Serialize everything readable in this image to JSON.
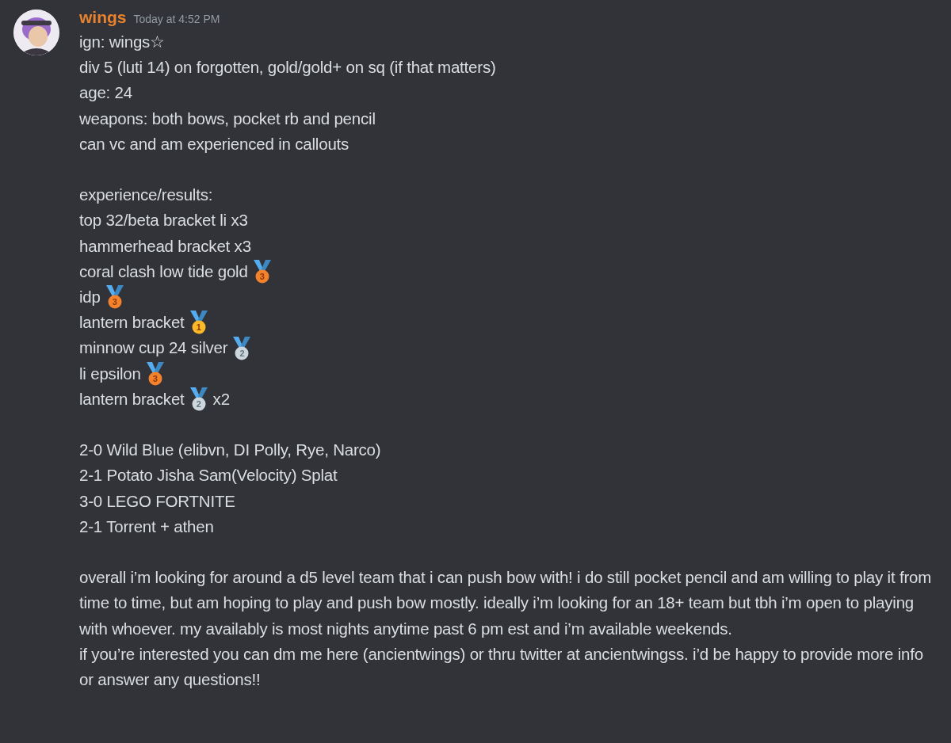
{
  "message": {
    "author": "wings",
    "timestamp": "Today at 4:52 PM",
    "paragraphs": [
      [
        {
          "text": "ign: wings☆"
        },
        {
          "text": "div 5 (luti 14) on forgotten, gold/gold+ on sq (if that matters)"
        },
        {
          "text": "age: 24"
        },
        {
          "text": "weapons: both bows, pocket rb and pencil"
        },
        {
          "text": "can vc and am experienced in callouts"
        }
      ],
      [
        {
          "text": "experience/results:"
        },
        {
          "text": "top 32/beta bracket li x3"
        },
        {
          "text": "hammerhead bracket x3"
        },
        {
          "text": "coral clash low tide gold",
          "medal": {
            "place": "3",
            "color": "#f4812b"
          }
        },
        {
          "text": "idp",
          "medal": {
            "place": "3",
            "color": "#f4812b"
          }
        },
        {
          "text": "lantern bracket",
          "medal": {
            "place": "1",
            "color": "#fbb829"
          }
        },
        {
          "text": "minnow cup 24 silver",
          "medal": {
            "place": "2",
            "color": "#ccd6dd"
          }
        },
        {
          "text": "li epsilon",
          "medal": {
            "place": "3",
            "color": "#f4812b"
          }
        },
        {
          "text": "lantern bracket",
          "medal": {
            "place": "2",
            "color": "#ccd6dd"
          },
          "suffix": "x2"
        }
      ],
      [
        {
          "text": "2-0 Wild Blue (elibvn, DI Polly, Rye, Narco)"
        },
        {
          "text": "2-1 Potato Jisha Sam(Velocity) Splat"
        },
        {
          "text": "3-0 LEGO FORTNITE"
        },
        {
          "text": "2-1 Torrent + athen"
        }
      ],
      [
        {
          "text": "overall i’m looking for around a d5 level team that i can push bow with! i do still pocket pencil and am willing to play it from time to time, but am hoping to play and push bow mostly. ideally i’m looking for an 18+ team but tbh i’m open to playing with whoever. my availably is most nights anytime past 6 pm est and i’m available weekends."
        },
        {
          "text": "if you’re interested you can dm me here (ancientwings) or thru twitter at ancientwingss. i’d be happy to provide more info or answer any questions!!"
        }
      ]
    ]
  }
}
